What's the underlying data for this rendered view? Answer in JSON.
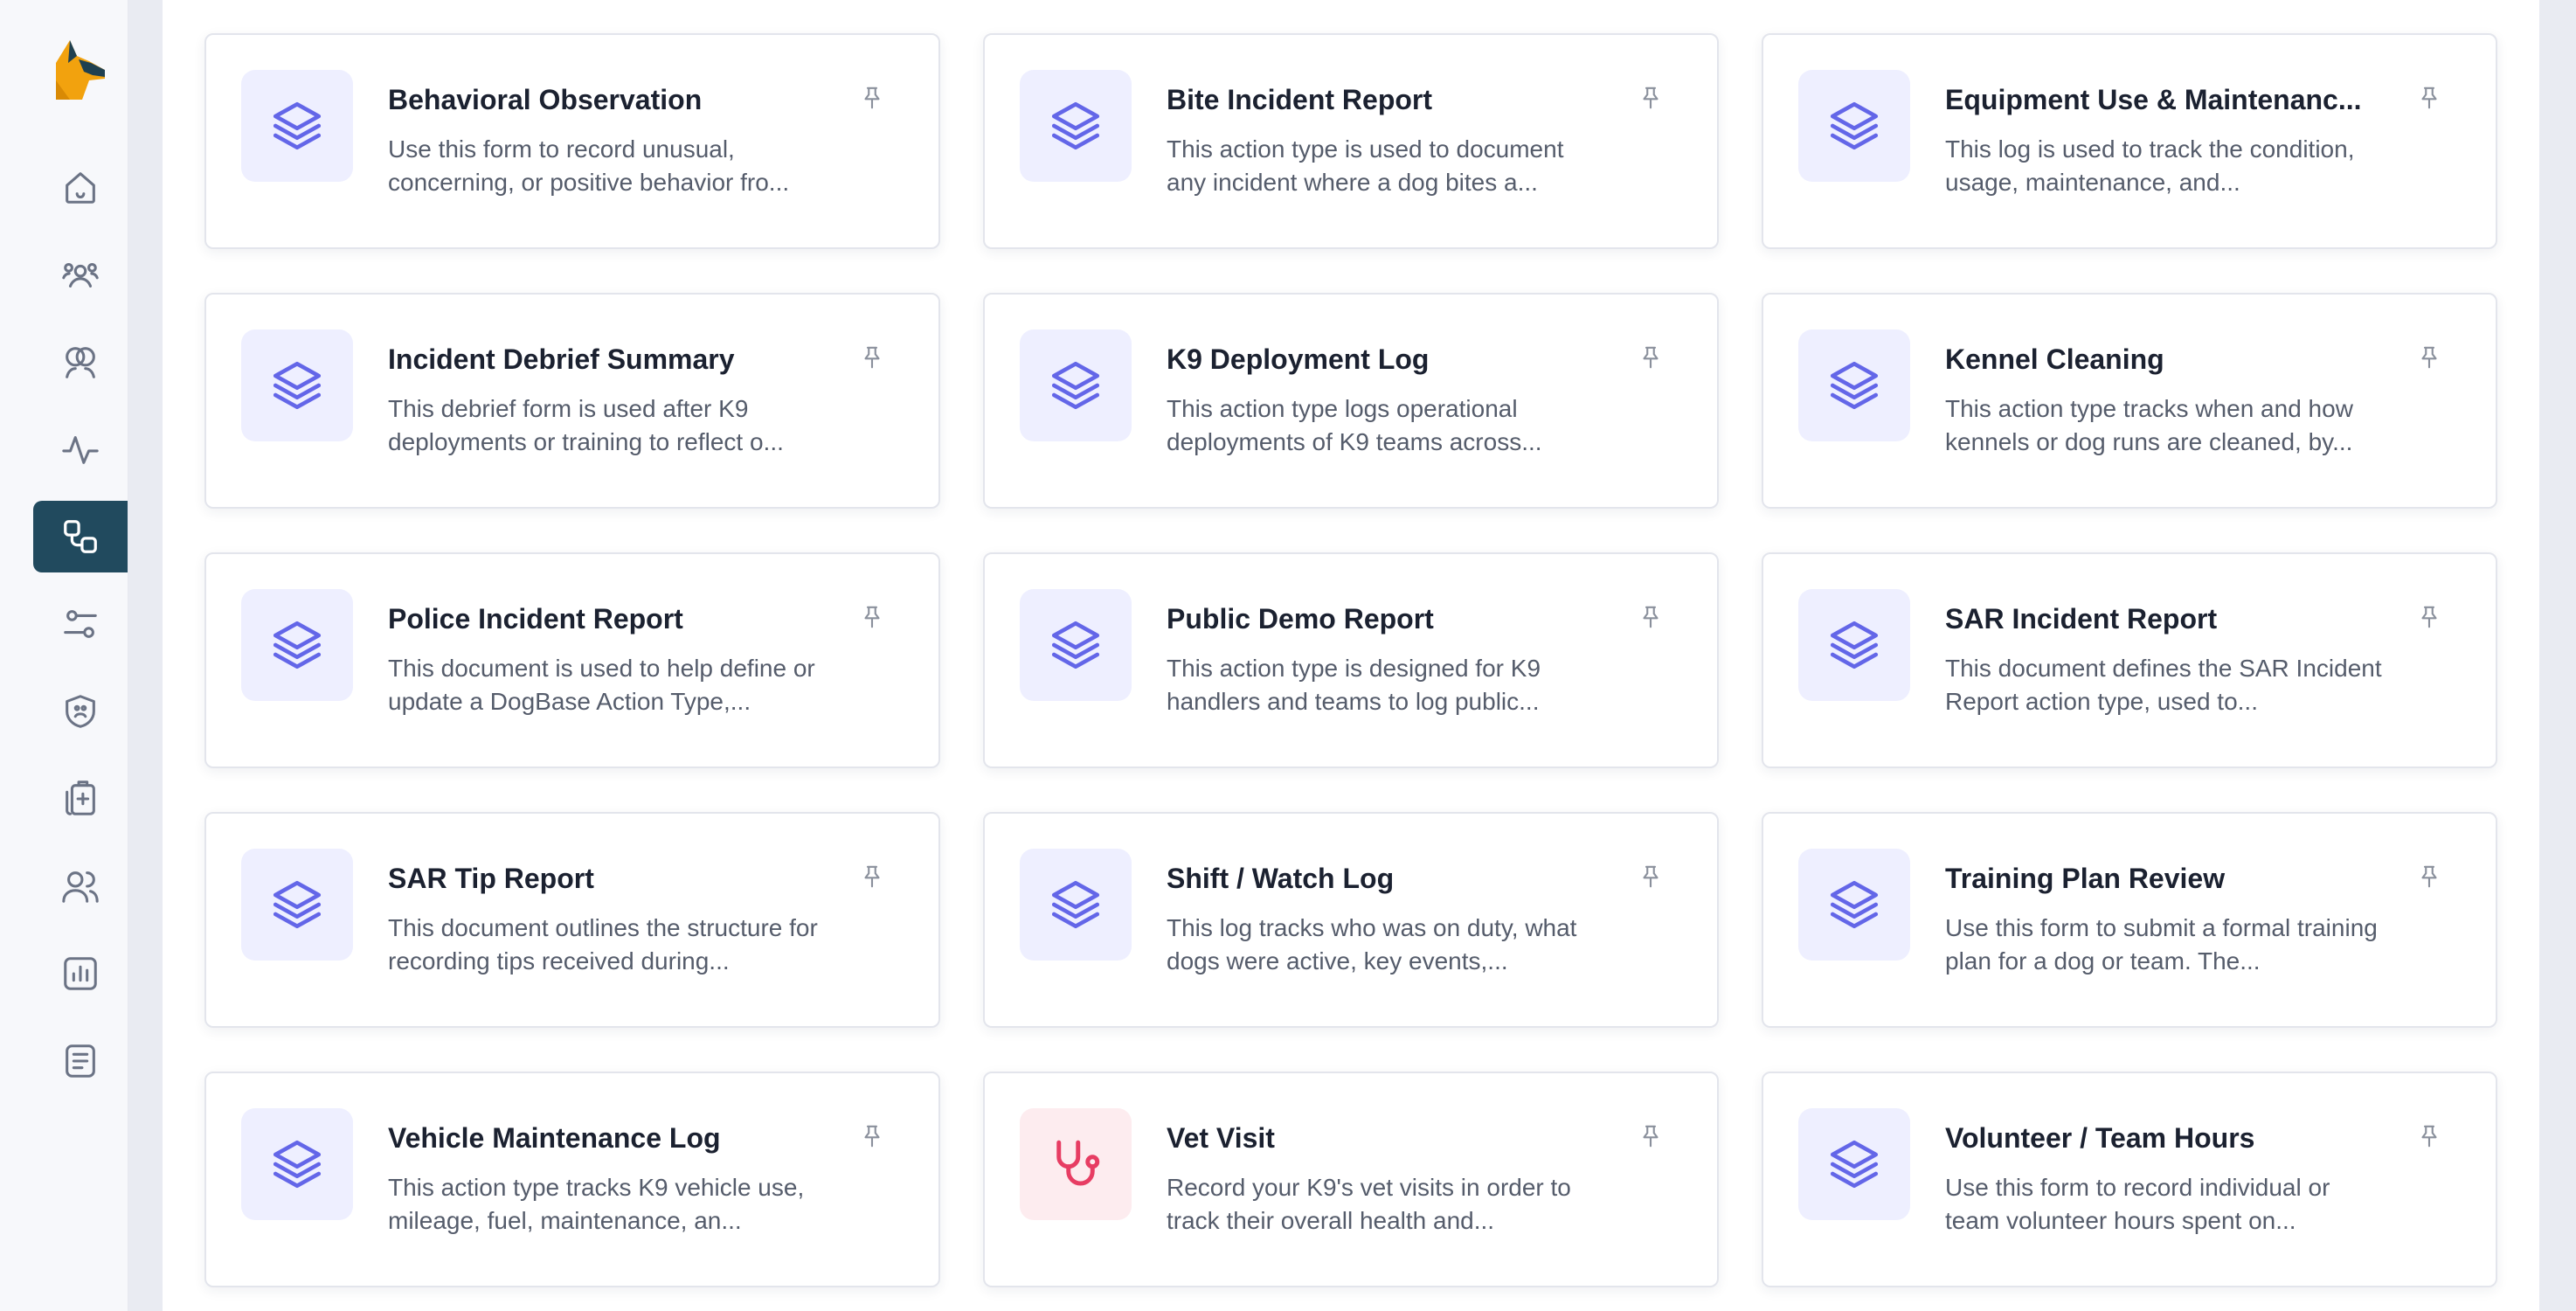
{
  "sidebar": {
    "items": [
      {
        "icon": "home-icon",
        "active": false
      },
      {
        "icon": "users-group-icon",
        "active": false
      },
      {
        "icon": "circles-icon",
        "active": false
      },
      {
        "icon": "activity-icon",
        "active": false
      },
      {
        "icon": "action-types-icon",
        "active": true
      },
      {
        "icon": "sliders-icon",
        "active": false
      },
      {
        "icon": "shield-paw-icon",
        "active": false
      },
      {
        "icon": "medical-clipboard-icon",
        "active": false
      },
      {
        "icon": "people-icon",
        "active": false
      },
      {
        "icon": "chart-icon",
        "active": false
      },
      {
        "icon": "document-icon",
        "active": false
      }
    ]
  },
  "colors": {
    "accent": "#6366e8",
    "active_nav": "#214a5e",
    "vet": "#e73d63"
  },
  "cards": [
    {
      "title": "Behavioral Observation",
      "description": "Use this form to record unusual, concerning, or positive behavior fro...",
      "icon": "layers-icon"
    },
    {
      "title": "Bite Incident Report",
      "description": "This action type is used to document any incident where a dog bites a...",
      "icon": "layers-icon"
    },
    {
      "title": "Equipment Use & Maintenanc...",
      "description": "This log is used to track the condition, usage, maintenance, and...",
      "icon": "layers-icon"
    },
    {
      "title": "Incident Debrief Summary",
      "description": "This debrief form is used after K9 deployments or training to reflect o...",
      "icon": "layers-icon"
    },
    {
      "title": "K9 Deployment Log",
      "description": "This action type logs operational deployments of K9 teams across...",
      "icon": "layers-icon"
    },
    {
      "title": "Kennel Cleaning",
      "description": "This action type tracks when and how kennels or dog runs are cleaned, by...",
      "icon": "layers-icon"
    },
    {
      "title": "Police Incident Report",
      "description": "This document is used to help define or update a DogBase Action Type,...",
      "icon": "layers-icon"
    },
    {
      "title": "Public Demo Report",
      "description": "This action type is designed for K9 handlers and teams to log public...",
      "icon": "layers-icon"
    },
    {
      "title": "SAR Incident Report",
      "description": "This document defines the SAR Incident Report action type, used to...",
      "icon": "layers-icon"
    },
    {
      "title": "SAR Tip Report",
      "description": "This document outlines the structure for recording tips received during...",
      "icon": "layers-icon"
    },
    {
      "title": "Shift / Watch Log",
      "description": "This log tracks who was on duty, what dogs were active, key events,...",
      "icon": "layers-icon"
    },
    {
      "title": "Training Plan Review",
      "description": "Use this form to submit a formal training plan for a dog or team. The...",
      "icon": "layers-icon"
    },
    {
      "title": "Vehicle Maintenance Log",
      "description": "This action type tracks K9 vehicle use, mileage, fuel, maintenance, an...",
      "icon": "layers-icon"
    },
    {
      "title": "Vet Visit",
      "description": "Record your K9's vet visits in order to track their overall health and...",
      "icon": "stethoscope-icon"
    },
    {
      "title": "Volunteer / Team Hours",
      "description": "Use this form to record individual or team volunteer hours spent on...",
      "icon": "layers-icon"
    }
  ]
}
